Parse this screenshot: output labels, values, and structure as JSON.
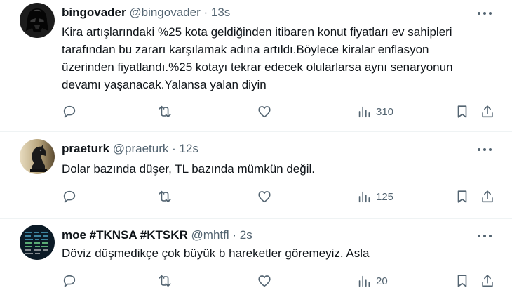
{
  "tweets": [
    {
      "name": "bingovader",
      "handle": "@bingovader",
      "separator": "·",
      "time": "13s",
      "text": "Kira artışlarındaki %25 kota geldiğinden itibaren konut fiyatları ev sahipleri tarafından bu zararı karşılamak adına artıldı.Böylece kiralar enflasyon üzerinden fiyatlandı.%25 kotayı tekrar edecek olularlarsa aynı senaryonun devamı yaşanacak.Yalansa yalan diyin",
      "views": "310",
      "avatar_icon": "darth-vader-avatar"
    },
    {
      "name": "praeturk",
      "handle": "@praeturk",
      "separator": "·",
      "time": "12s",
      "text": "Dolar bazında düşer, TL bazında mümkün değil.",
      "views": "125",
      "avatar_icon": "chess-knight-avatar"
    },
    {
      "name": "moe #TKNSA #KTSKR",
      "handle": "@mhtfl",
      "separator": "·",
      "time": "2s",
      "text": "Döviz düşmedikçe çok büyük b hareketler göremeyiz. Asla",
      "views": "20",
      "avatar_icon": "stock-ticker-avatar"
    }
  ],
  "colors": {
    "text": "#0f1419",
    "secondary": "#536471",
    "divider": "#eff3f4"
  }
}
